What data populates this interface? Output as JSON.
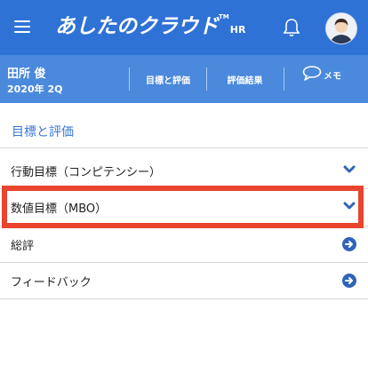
{
  "app": {
    "logo_text": "あしたのクラウド",
    "logo_tm": "TM",
    "logo_suffix": "HR"
  },
  "user": {
    "name": "田所 俊",
    "period": "2020年 2Q"
  },
  "subnav": {
    "items": [
      {
        "label": "目標と評価"
      },
      {
        "label": "評価結果"
      }
    ],
    "memo_label": "メモ"
  },
  "section": {
    "title": "目標と評価"
  },
  "rows": [
    {
      "label": "行動目標（コンピテンシー）",
      "icon": "chevron-down-icon"
    },
    {
      "label": "数値目標（MBO）",
      "icon": "chevron-down-icon",
      "highlighted": true
    },
    {
      "label": "総評",
      "icon": "arrow-right-circle-icon"
    },
    {
      "label": "フィードバック",
      "icon": "arrow-right-circle-icon"
    }
  ],
  "colors": {
    "header_bg": "#2f72d6",
    "subbar_bg": "#4a89dc",
    "accent": "#3a78d6",
    "highlight": "#e8442e"
  }
}
